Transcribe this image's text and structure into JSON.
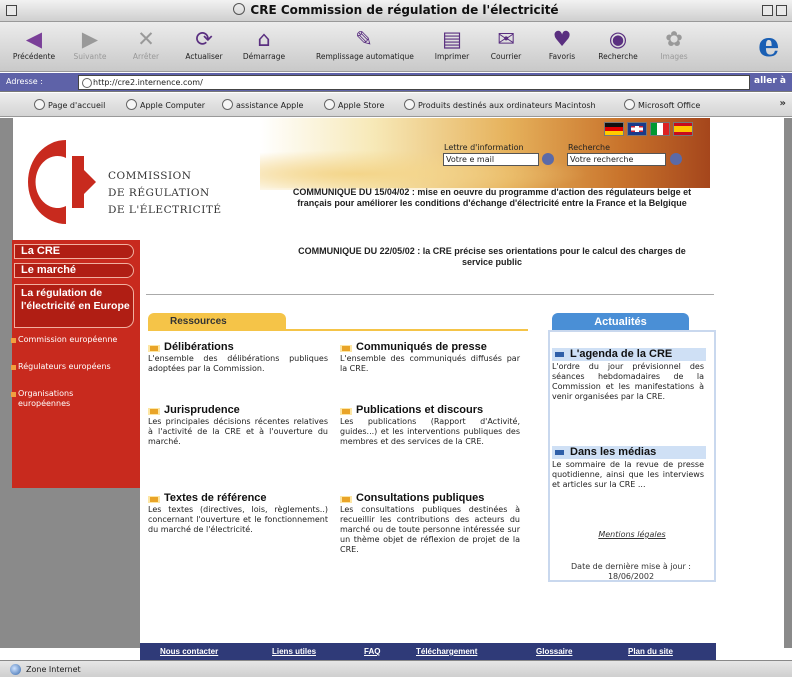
{
  "window": {
    "title": "CRE Commission de régulation de l'électricité"
  },
  "toolbar": {
    "buttons": [
      {
        "label": "Précédente",
        "icon": "back-arrow-icon",
        "glyph": "◀",
        "color": "#7a3f98",
        "enabled": true
      },
      {
        "label": "Suivante",
        "icon": "forward-arrow-icon",
        "glyph": "▶",
        "color": "#999999",
        "enabled": false
      },
      {
        "label": "Arrêter",
        "icon": "stop-icon",
        "glyph": "✕",
        "color": "#999999",
        "enabled": false
      },
      {
        "label": "Actualiser",
        "icon": "refresh-icon",
        "glyph": "⟳",
        "color": "#5a2f80",
        "enabled": true
      },
      {
        "label": "Démarrage",
        "icon": "home-icon",
        "glyph": "⌂",
        "color": "#5a2f80",
        "enabled": true
      },
      {
        "label": "Remplissage automatique",
        "icon": "autofill-icon",
        "glyph": "✎",
        "color": "#5a2f80",
        "enabled": true
      },
      {
        "label": "Imprimer",
        "icon": "print-icon",
        "glyph": "▤",
        "color": "#5a2f80",
        "enabled": true
      },
      {
        "label": "Courrier",
        "icon": "mail-icon",
        "glyph": "✉",
        "color": "#5a2f80",
        "enabled": true
      },
      {
        "label": "Favoris",
        "icon": "favorites-heart-icon",
        "glyph": "♥",
        "color": "#5a2f80",
        "enabled": true
      },
      {
        "label": "Recherche",
        "icon": "search-eye-icon",
        "glyph": "◉",
        "color": "#5a2f80",
        "enabled": true
      },
      {
        "label": "Images",
        "icon": "images-icon",
        "glyph": "✿",
        "color": "#999999",
        "enabled": false
      }
    ]
  },
  "address": {
    "label": "Adresse :",
    "url": "http://cre2.internence.com/",
    "go_label": "aller à"
  },
  "favorites": [
    "Page d'accueil",
    "Apple Computer",
    "assistance Apple",
    "Apple Store",
    "Produits destinés aux ordinateurs Macintosh",
    "Microsoft Office"
  ],
  "site": {
    "logo_lines": [
      "COMMISSION",
      "DE RÉGULATION",
      "DE L'ÉLECTRICITÉ"
    ],
    "newsletter_label": "Lettre d'information",
    "newsletter_placeholder": "Votre e mail",
    "search_label": "Recherche",
    "search_placeholder": "Votre recherche",
    "communiques": [
      "COMMUNIQUE DU 15/04/02 : mise en oeuvre du programme d'action des régulateurs belge et français pour améliorer les conditions d'échange d'électricité entre la France et la Belgique",
      "COMMUNIQUE DU 22/05/02 : la CRE précise ses orientations pour le calcul des charges de service public"
    ],
    "nav": [
      "La CRE",
      "Le marché",
      "La régulation de l'électricité en Europe"
    ],
    "subnav": [
      "Commission européenne",
      "Régulateurs européens",
      "Organisations européennes"
    ],
    "resources_tab": "Ressources",
    "sections": [
      {
        "title": "Délibérations",
        "text": "L'ensemble des délibérations publiques adoptées par la Commission."
      },
      {
        "title": "Communiqués de presse",
        "text": "L'ensemble des communiqués diffusés par la CRE."
      },
      {
        "title": "Jurisprudence",
        "text": "Les principales décisions récentes relatives à l'activité de la CRE et à l'ouverture du marché."
      },
      {
        "title": "Publications et discours",
        "text": "Les publications (Rapport d'Activité, guides...) et les interventions publiques des membres et des services de la CRE."
      },
      {
        "title": "Textes de référence",
        "text": "Les textes (directives, lois, règlements..) concernant l'ouverture et le fonctionnement du marché de l'électricité."
      },
      {
        "title": "Consultations publiques",
        "text": "Les consultations publiques destinées à recueillir les contributions des acteurs du marché ou de toute personne intéressée sur un thème objet de réflexion de projet de la CRE."
      }
    ],
    "actualites": {
      "tab": "Actualités",
      "items": [
        {
          "title": "L'agenda de la CRE",
          "text": "L'ordre du jour prévisionnel des séances hebdomadaires de la Commission et les manifestations à venir organisées par la CRE."
        },
        {
          "title": "Dans les médias",
          "text": "Le sommaire de la revue de presse quotidienne, ainsi que les interviews et articles sur la CRE ..."
        }
      ],
      "mentions": "Mentions légales",
      "update": "Date de dernière mise à jour : 18/06/2002"
    },
    "footer": [
      "Nous contacter",
      "Liens utiles",
      "FAQ",
      "Téléchargement",
      "Glossaire",
      "Plan du site"
    ]
  },
  "status": {
    "text": "Zone Internet"
  },
  "colors": {
    "brand_red": "#c82a1e",
    "resources_yellow": "#f5c448",
    "news_blue": "#4a8fd6",
    "footer_navy": "#2f3a78"
  }
}
